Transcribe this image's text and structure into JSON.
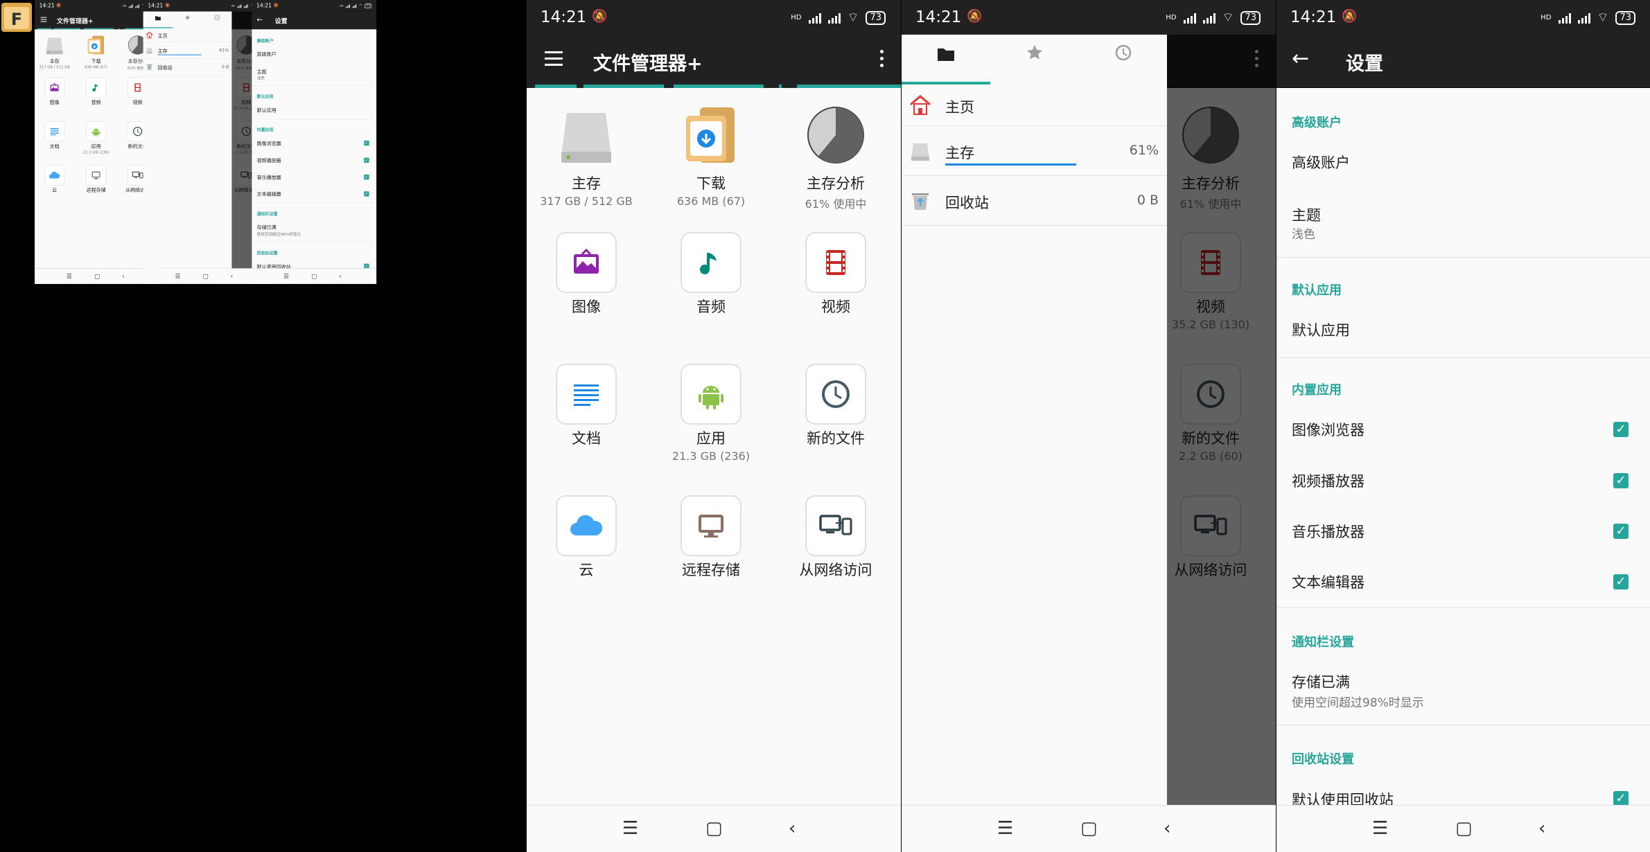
{
  "status": {
    "time": "14:21",
    "signal_label": "HD",
    "battery": "73"
  },
  "main": {
    "title": "文件管理器+",
    "items": [
      {
        "label": "主存",
        "sub": "317 GB / 512 GB"
      },
      {
        "label": "下载",
        "sub": "636 MB (67)"
      },
      {
        "label": "主存分析",
        "sub": "61% 使用中"
      },
      {
        "label": "图像",
        "sub": ""
      },
      {
        "label": "音频",
        "sub": ""
      },
      {
        "label": "视频",
        "sub": ""
      },
      {
        "label": "文档",
        "sub": ""
      },
      {
        "label": "应用",
        "sub": "21.3 GB (236)"
      },
      {
        "label": "新的文件",
        "sub": ""
      },
      {
        "label": "云",
        "sub": ""
      },
      {
        "label": "远程存储",
        "sub": ""
      },
      {
        "label": "从网络访问",
        "sub": ""
      }
    ],
    "storage_used_fraction": 0.61
  },
  "drawer": {
    "items": [
      {
        "label": "主页",
        "value": ""
      },
      {
        "label": "主存",
        "value": "61%"
      },
      {
        "label": "回收站",
        "value": "0 B"
      }
    ],
    "storage_bar_fraction": 0.61,
    "bg_visible": [
      {
        "label": "主存分析",
        "sub": "61% 使用中"
      },
      {
        "label": "视频",
        "sub": "35.2 GB (130)"
      },
      {
        "label": "新的文件",
        "sub": "2.2 GB (60)"
      },
      {
        "label": "从网络访问",
        "sub": ""
      }
    ]
  },
  "settings": {
    "title": "设置",
    "sections": {
      "premium": "高级账户",
      "default_apps": "默认应用",
      "builtin": "内置应用",
      "notification": "通知栏设置",
      "recycle": "回收站设置"
    },
    "items": {
      "premium_account": "高级账户",
      "theme": "主题",
      "theme_value": "浅色",
      "default_apps": "默认应用",
      "image_viewer": "图像浏览器",
      "video_player": "视频播放器",
      "music_player": "音乐播放器",
      "text_editor": "文本编辑器",
      "storage_full": "存储已满",
      "storage_full_desc": "使用空间超过98%时显示",
      "default_recycle": "默认使用回收站"
    },
    "checked": [
      true,
      true,
      true,
      true,
      true
    ]
  },
  "colors": {
    "accent": "#26a69a",
    "appbar": "#212121",
    "background": "#fafafa"
  },
  "app_icon_letter": "F"
}
